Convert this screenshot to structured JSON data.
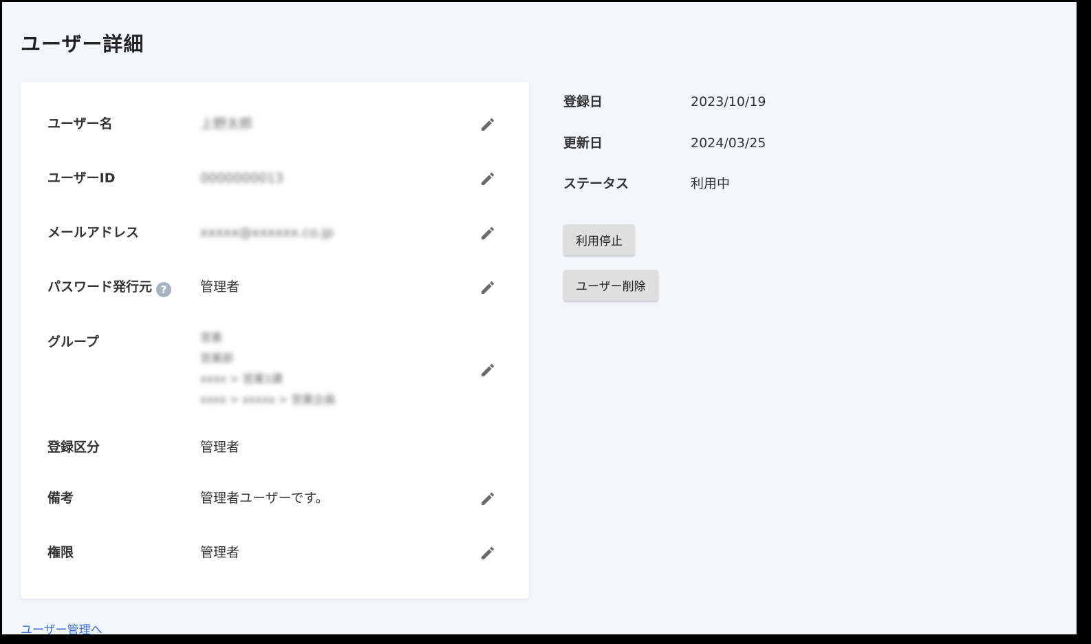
{
  "page": {
    "title": "ユーザー詳細"
  },
  "details": {
    "username": {
      "label": "ユーザー名",
      "value": "上野太郎"
    },
    "user_id": {
      "label": "ユーザーID",
      "value": "0000000013"
    },
    "email": {
      "label": "メールアドレス",
      "value": "xxxxx@xxxxxx.co.jp"
    },
    "password_issuer": {
      "label": "パスワード発行元",
      "help_icon": "?",
      "value": "管理者"
    },
    "group": {
      "label": "グループ",
      "values": [
        "営業",
        "営業部",
        "xxxx > 営業1課",
        "xxxx > xxxxx > 営業企画"
      ]
    },
    "registration_type": {
      "label": "登録区分",
      "value": "管理者"
    },
    "notes": {
      "label": "備考",
      "value": "管理者ユーザーです。"
    },
    "permission": {
      "label": "権限",
      "value": "管理者"
    }
  },
  "meta": {
    "registered": {
      "label": "登録日",
      "value": "2023/10/19"
    },
    "updated": {
      "label": "更新日",
      "value": "2024/03/25"
    },
    "status": {
      "label": "ステータス",
      "value": "利用中"
    }
  },
  "actions": {
    "suspend_label": "利用停止",
    "delete_label": "ユーザー削除"
  },
  "footer": {
    "back_link": "ユーザー管理へ"
  },
  "icons": {
    "edit": "pencil-icon",
    "help": "question-circle-icon"
  },
  "colors": {
    "background": "#f3f6fa",
    "card": "#ffffff",
    "link": "#3a6fd1",
    "button": "#dfdfdf",
    "icon": "#6b6b6b"
  }
}
